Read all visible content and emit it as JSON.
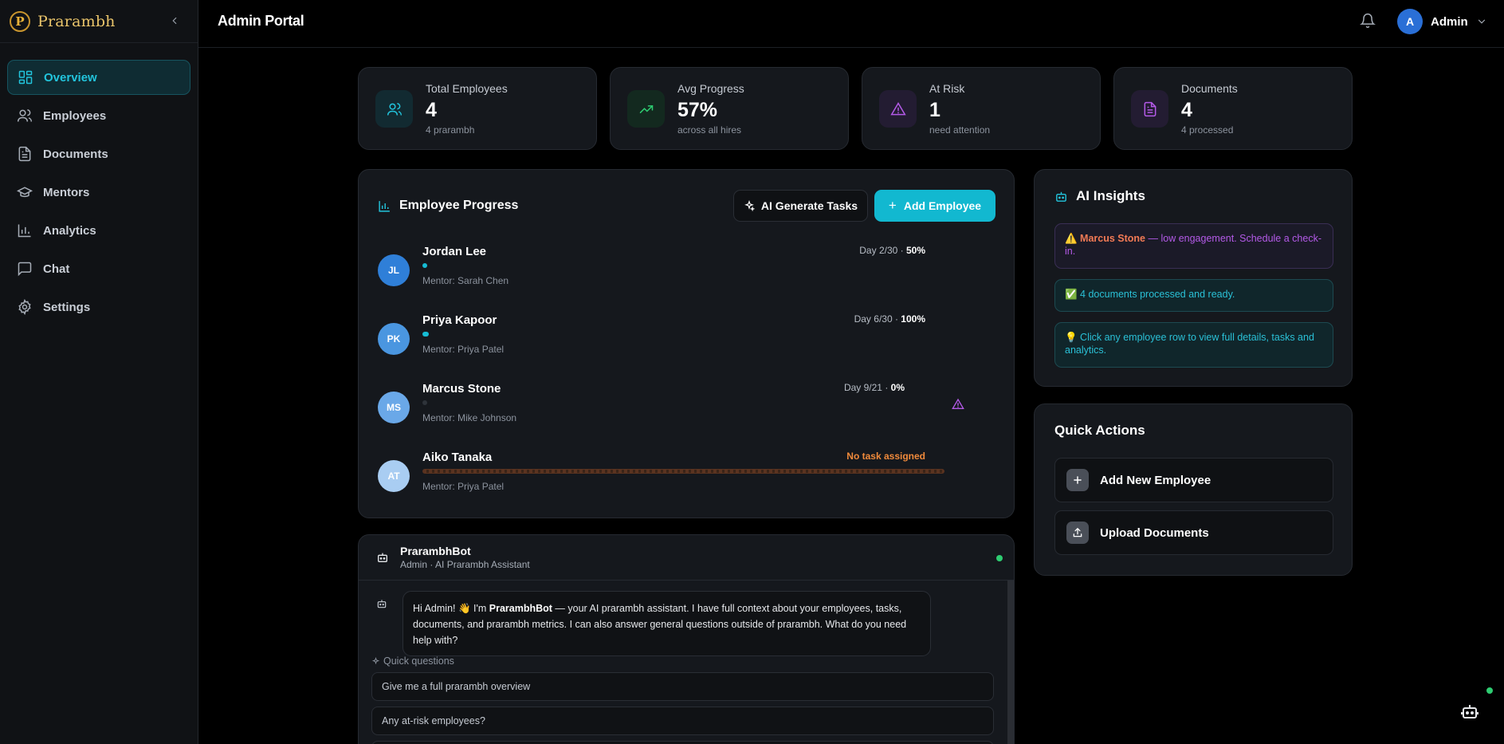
{
  "brand": {
    "logo_letter": "P",
    "name": "Prarambh"
  },
  "sidebar": {
    "items": [
      {
        "label": "Overview",
        "icon": "layout-dashboard-icon",
        "active": true
      },
      {
        "label": "Employees",
        "icon": "users-icon"
      },
      {
        "label": "Documents",
        "icon": "file-text-icon"
      },
      {
        "label": "Mentors",
        "icon": "graduation-cap-icon"
      },
      {
        "label": "Analytics",
        "icon": "bar-chart-icon"
      },
      {
        "label": "Chat",
        "icon": "message-square-icon"
      },
      {
        "label": "Settings",
        "icon": "settings-icon"
      }
    ]
  },
  "header": {
    "title": "Admin Portal",
    "user_initial": "A",
    "user_name": "Admin"
  },
  "stats": [
    {
      "label": "Total Employees",
      "value": "4",
      "sub": "4 prarambh",
      "icon": "users-icon",
      "color": "#22c4dc"
    },
    {
      "label": "Avg Progress",
      "value": "57%",
      "sub": "across all hires",
      "icon": "trending-up-icon",
      "color": "#2ecc71"
    },
    {
      "label": "At Risk",
      "value": "1",
      "sub": "need attention",
      "icon": "alert-triangle-icon",
      "color": "#b45ae8"
    },
    {
      "label": "Documents",
      "value": "4",
      "sub": "4 processed",
      "icon": "file-text-icon",
      "color": "#b45ae8"
    }
  ],
  "progress": {
    "title": "Employee Progress",
    "ai_button": "AI Generate Tasks",
    "add_button": "Add Employee",
    "employees": [
      {
        "initials": "JL",
        "name": "Jordan Lee",
        "mentor": "Mentor: Sarah Chen",
        "day": "Day 2/30 · ",
        "pct": "50%",
        "progress": 0.5,
        "color": "#2f7fd8"
      },
      {
        "initials": "PK",
        "name": "Priya Kapoor",
        "mentor": "Mentor: Priya Patel",
        "day": "Day 6/30 · ",
        "pct": "100%",
        "progress": 1.0,
        "color": "#4a96e0"
      },
      {
        "initials": "MS",
        "name": "Marcus Stone",
        "mentor": "Mentor: Mike Johnson",
        "day": "Day 9/21 · ",
        "pct": "0%",
        "progress": 0,
        "color": "#6aa8e8",
        "at_risk": true
      },
      {
        "initials": "AT",
        "name": "Aiko Tanaka",
        "mentor": "Mentor: Priya Patel",
        "status": "No task assigned",
        "color": "#a9cdf2"
      }
    ]
  },
  "insights": {
    "title": "AI Insights",
    "warn_prefix": "⚠️ ",
    "warn_name": "Marcus Stone",
    "warn_text": " — low engagement. Schedule a check-in.",
    "ok_text": "✅ 4 documents processed and ready.",
    "tip_text": "💡 Click any employee row to view full details, tasks and analytics."
  },
  "quick_actions": {
    "title": "Quick Actions",
    "items": [
      {
        "label": "Add New Employee",
        "icon": "plus-icon"
      },
      {
        "label": "Upload Documents",
        "icon": "upload-icon"
      }
    ]
  },
  "chat": {
    "bot_name": "PrarambhBot",
    "subtitle": "Admin · AI Prarambh Assistant",
    "greeting_prefix": "Hi Admin! 👋 I'm ",
    "greeting_bot": "PrarambhBot",
    "greeting_rest": " — your AI prarambh assistant. I have full context about your employees, tasks, documents, and prarambh metrics. I can also answer general questions outside of prarambh. What do you need help with?",
    "quick_label": "Quick questions",
    "quick_questions": [
      "Give me a full prarambh overview",
      "Any at-risk employees?"
    ]
  }
}
